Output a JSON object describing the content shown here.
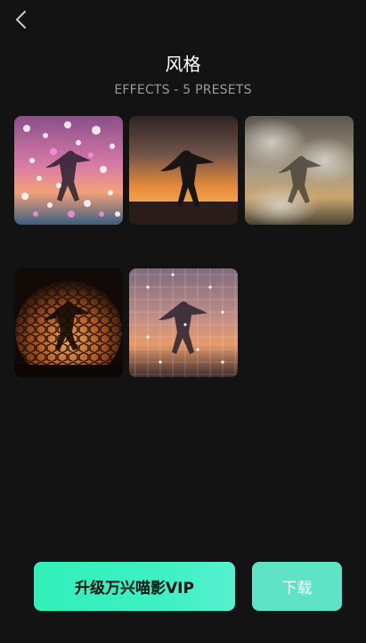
{
  "header": {
    "title": "风格",
    "subtitle": "EFFECTS - 5 PRESETS"
  },
  "presets": [
    {
      "effect": "bokeh-sparkle"
    },
    {
      "effect": "sunset-grain"
    },
    {
      "effect": "smoke"
    },
    {
      "effect": "hexagon-grid"
    },
    {
      "effect": "star-grid"
    }
  ],
  "footer": {
    "vip_label": "升级万兴喵影VIP",
    "download_label": "下载"
  },
  "colors": {
    "background": "#131313",
    "accent": "#31f0b9",
    "download": "#5ee3c7"
  },
  "icons": {
    "back": "back-chevron-icon"
  }
}
